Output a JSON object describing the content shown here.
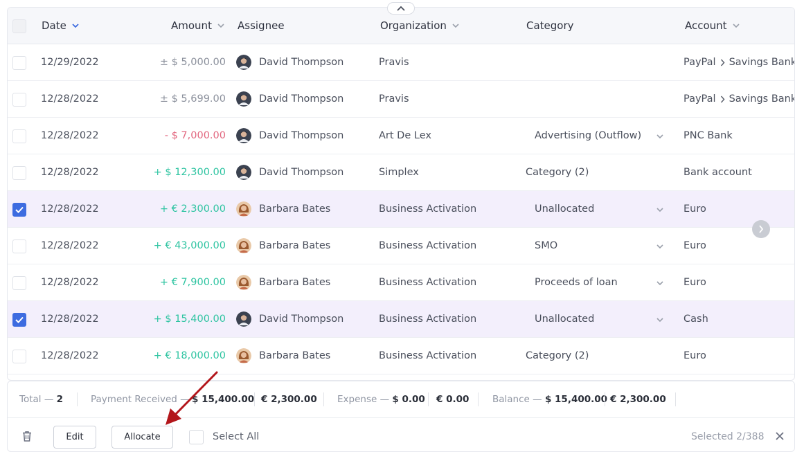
{
  "columns": {
    "date": "Date",
    "amount": "Amount",
    "assignee": "Assignee",
    "organization": "Organization",
    "category": "Category",
    "account": "Account"
  },
  "rows": [
    {
      "checked": false,
      "date": "12/29/2022",
      "amount": "± $ 5,000.00",
      "amount_kind": "neutral",
      "assignee": "David Thompson",
      "avatar": "male",
      "org": "Pravis",
      "category": "",
      "category_dropdown": false,
      "account": "PayPal",
      "account_sub": "Savings Bank"
    },
    {
      "checked": false,
      "date": "12/28/2022",
      "amount": "± $ 5,699.00",
      "amount_kind": "neutral",
      "assignee": "David Thompson",
      "avatar": "male",
      "org": "Pravis",
      "category": "",
      "category_dropdown": false,
      "account": "PayPal",
      "account_sub": "Savings Bank"
    },
    {
      "checked": false,
      "date": "12/28/2022",
      "amount": "- $ 7,000.00",
      "amount_kind": "neg",
      "assignee": "David Thompson",
      "avatar": "male",
      "org": "Art De Lex",
      "category": "Advertising (Outflow)",
      "category_dropdown": true,
      "account": "PNC Bank",
      "account_sub": ""
    },
    {
      "checked": false,
      "date": "12/28/2022",
      "amount": "+ $ 12,300.00",
      "amount_kind": "pos",
      "assignee": "David Thompson",
      "avatar": "male",
      "org": "Simplex",
      "category": "Category (2)",
      "category_dropdown": false,
      "account": "Bank account",
      "account_sub": ""
    },
    {
      "checked": true,
      "date": "12/28/2022",
      "amount": "+ € 2,300.00",
      "amount_kind": "pos",
      "assignee": "Barbara Bates",
      "avatar": "female",
      "org": "Business Activation",
      "category": "Unallocated",
      "category_dropdown": true,
      "account": "Euro",
      "account_sub": ""
    },
    {
      "checked": false,
      "date": "12/28/2022",
      "amount": "+ € 43,000.00",
      "amount_kind": "pos",
      "assignee": "Barbara Bates",
      "avatar": "female",
      "org": "Business Activation",
      "category": "SMO",
      "category_dropdown": true,
      "account": "Euro",
      "account_sub": ""
    },
    {
      "checked": false,
      "date": "12/28/2022",
      "amount": "+ € 7,900.00",
      "amount_kind": "pos",
      "assignee": "Barbara Bates",
      "avatar": "female",
      "org": "Business Activation",
      "category": "Proceeds of loan",
      "category_dropdown": true,
      "account": "Euro",
      "account_sub": ""
    },
    {
      "checked": true,
      "date": "12/28/2022",
      "amount": "+ $ 15,400.00",
      "amount_kind": "pos",
      "assignee": "David Thompson",
      "avatar": "male",
      "org": "Business Activation",
      "category": "Unallocated",
      "category_dropdown": true,
      "account": "Cash",
      "account_sub": ""
    },
    {
      "checked": false,
      "date": "12/28/2022",
      "amount": "+ € 18,000.00",
      "amount_kind": "pos",
      "assignee": "Barbara Bates",
      "avatar": "female",
      "org": "Business Activation",
      "category": "Category (2)",
      "category_dropdown": false,
      "account": "Euro",
      "account_sub": ""
    }
  ],
  "totals": {
    "total_label": "Total —",
    "total_value": "2",
    "payment_label": "Payment Received —",
    "payment_usd": "$ 15,400.00",
    "payment_eur": "€ 2,300.00",
    "expense_label": "Expense —",
    "expense_usd": "$ 0.00",
    "expense_eur": "€ 0.00",
    "balance_label": "Balance —",
    "balance_usd": "$ 15,400.00",
    "balance_eur": "€ 2,300.00"
  },
  "actions": {
    "edit_label": "Edit",
    "allocate_label": "Allocate",
    "select_all_label": "Select All",
    "selected_count": "Selected 2/388"
  },
  "colors": {
    "accent": "#3d6ce0",
    "positive": "#2ec4a1",
    "negative": "#e2677f",
    "selected_row": "#f3effc",
    "annotation_arrow": "#b3161b"
  }
}
